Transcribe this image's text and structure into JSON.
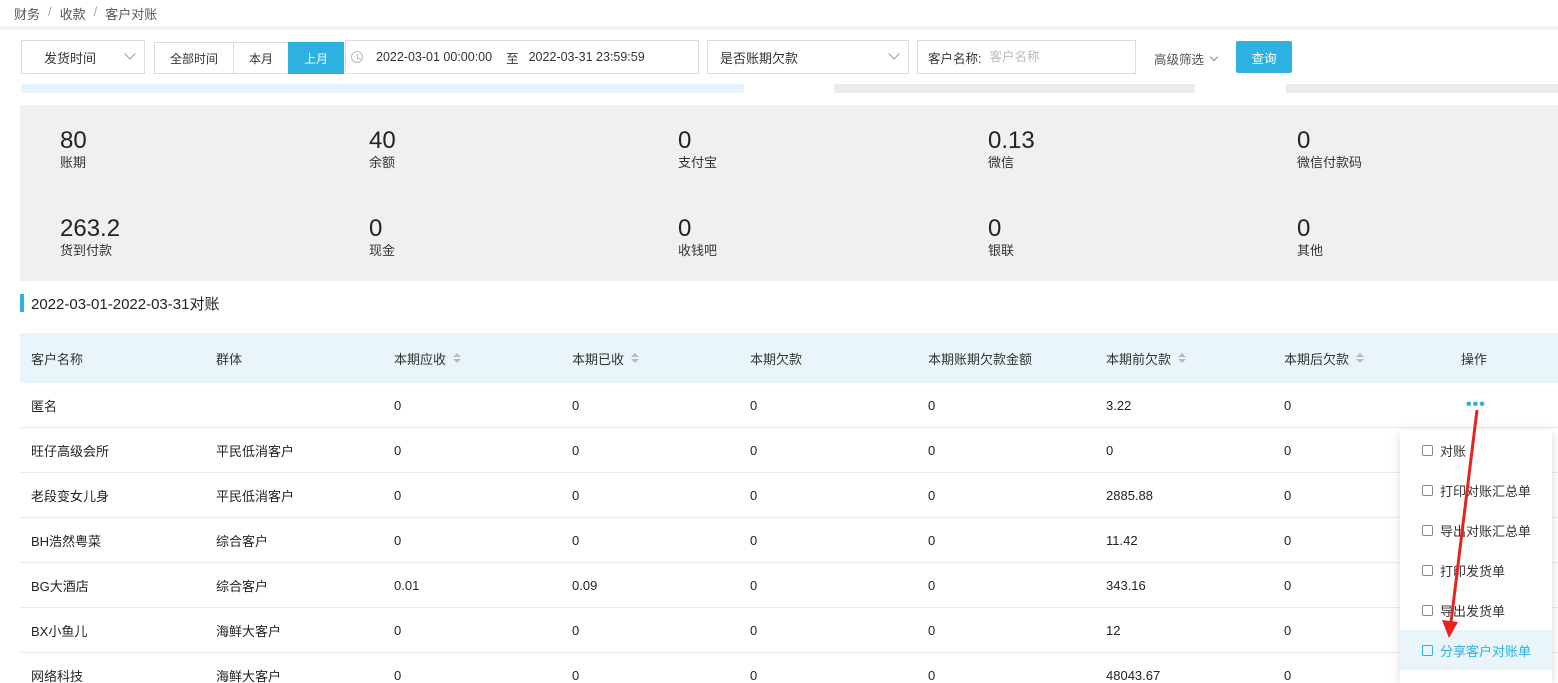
{
  "breadcrumb": [
    "财务",
    "收款",
    "客户对账"
  ],
  "filters": {
    "date_type": "发货时间",
    "ranges": [
      "全部时间",
      "本月",
      "上月"
    ],
    "active_range": "上月",
    "start": "2022-03-01 00:00:00",
    "to_label": "至",
    "end": "2022-03-31 23:59:59",
    "overdue_select": "是否账期欠款",
    "name_label": "客户名称:",
    "name_placeholder": "客户名称",
    "advanced": "高级筛选",
    "query": "查询"
  },
  "stats": [
    {
      "value": "80",
      "label": "账期"
    },
    {
      "value": "40",
      "label": "余额"
    },
    {
      "value": "0",
      "label": "支付宝"
    },
    {
      "value": "0.13",
      "label": "微信"
    },
    {
      "value": "0",
      "label": "微信付款码"
    },
    {
      "value": "263.2",
      "label": "货到付款"
    },
    {
      "value": "0",
      "label": "现金"
    },
    {
      "value": "0",
      "label": "收钱吧"
    },
    {
      "value": "0",
      "label": "银联"
    },
    {
      "value": "0",
      "label": "其他"
    }
  ],
  "section_title": "2022-03-01-2022-03-31对账",
  "table": {
    "headers": [
      "客户名称",
      "群体",
      "本期应收",
      "本期已收",
      "本期欠款",
      "本期账期欠款金额",
      "本期前欠款",
      "本期后欠款",
      "操作"
    ],
    "rows": [
      [
        "匿名",
        "",
        "0",
        "0",
        "0",
        "0",
        "3.22",
        "0"
      ],
      [
        "旺仔高级会所",
        "平民低消客户",
        "0",
        "0",
        "0",
        "0",
        "0",
        "0"
      ],
      [
        "老段变女儿身",
        "平民低消客户",
        "0",
        "0",
        "0",
        "0",
        "2885.88",
        "0"
      ],
      [
        "BH浩然粤菜",
        "综合客户",
        "0",
        "0",
        "0",
        "0",
        "11.42",
        "0"
      ],
      [
        "BG大酒店",
        "综合客户",
        "0.01",
        "0.09",
        "0",
        "0",
        "343.16",
        "0"
      ],
      [
        "BX小鱼儿",
        "海鲜大客户",
        "0",
        "0",
        "0",
        "0",
        "12",
        "0"
      ],
      [
        "网络科技",
        "海鲜大客户",
        "0",
        "0",
        "0",
        "0",
        "48043.67",
        "0"
      ]
    ],
    "action_icon": "more-dots-icon"
  },
  "menu": {
    "items": [
      "对账",
      "打印对账汇总单",
      "导出对账汇总单",
      "打印发货单",
      "导出发货单",
      "分享客户对账单"
    ],
    "highlighted": "分享客户对账单"
  },
  "colors": {
    "accent": "#2eb0e0",
    "arrow": "#e8231f",
    "summary_bg": "#f0f0f0",
    "header_bg": "#eaf5fb"
  }
}
